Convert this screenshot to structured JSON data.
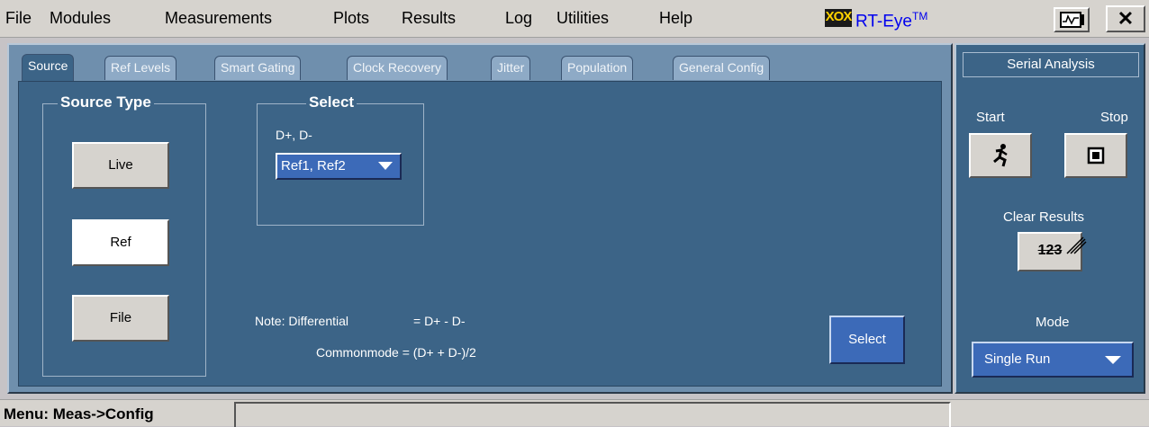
{
  "menu": {
    "items": [
      "File",
      "Modules",
      "Measurements",
      "Plots",
      "Results",
      "Log",
      "Utilities",
      "Help"
    ],
    "logo": "XOX",
    "product": "RT-Eye",
    "product_tm": "TM",
    "close": "✕",
    "scope_icon": "scope-icon"
  },
  "tabs": [
    "Source",
    "Ref Levels",
    "Smart Gating",
    "Clock Recovery",
    "Jitter",
    "Population",
    "General Config"
  ],
  "source_type": {
    "title": "Source Type",
    "buttons": [
      "Live",
      "Ref",
      "File"
    ],
    "selected": "Ref"
  },
  "select_group": {
    "title": "Select",
    "channel_label": "D+, D-",
    "dropdown_value": "Ref1, Ref2"
  },
  "notes": {
    "differential_label": "Note: Differential",
    "differential_formula": "= D+ - D-",
    "commonmode": "Commonmode = (D+ + D-)/2"
  },
  "select_button": "Select",
  "right_panel": {
    "title": "Serial Analysis",
    "start_label": "Start",
    "stop_label": "Stop",
    "clear_label": "Clear Results",
    "clear_icon_text": "123",
    "mode_label": "Mode",
    "mode_value": "Single Run"
  },
  "status": {
    "text": "Menu: Meas->Config"
  },
  "colors": {
    "panel_dark": "#3c6487",
    "panel_light": "#6f8fad",
    "button_blue": "#3c6ab8",
    "menu_gray": "#d6d3ce"
  }
}
